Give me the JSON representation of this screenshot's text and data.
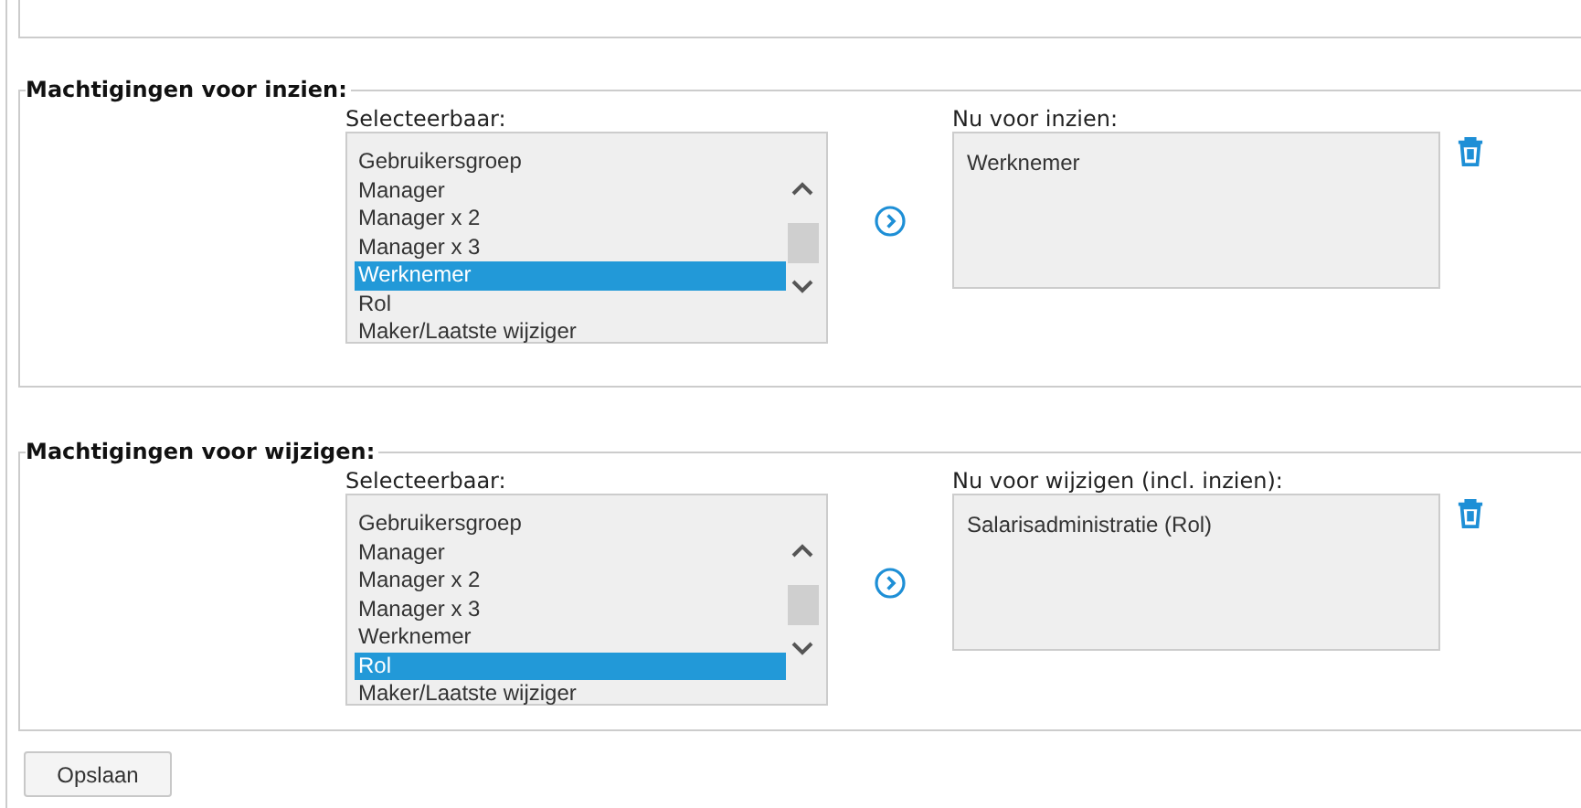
{
  "sections": [
    {
      "legend": "Machtigingen voor inzien:",
      "available_label": "Selecteerbaar:",
      "available": [
        {
          "label": "Gebruikersgroep",
          "selected": false
        },
        {
          "label": "Manager",
          "selected": false
        },
        {
          "label": "Manager x 2",
          "selected": false
        },
        {
          "label": "Manager x 3",
          "selected": false
        },
        {
          "label": "Werknemer",
          "selected": true
        },
        {
          "label": "Rol",
          "selected": false
        },
        {
          "label": "Maker/Laatste wijziger",
          "selected": false
        }
      ],
      "current_label": "Nu voor inzien:",
      "current": [
        "Werknemer"
      ]
    },
    {
      "legend": "Machtigingen voor wijzigen:",
      "available_label": "Selecteerbaar:",
      "available": [
        {
          "label": "Gebruikersgroep",
          "selected": false
        },
        {
          "label": "Manager",
          "selected": false
        },
        {
          "label": "Manager x 2",
          "selected": false
        },
        {
          "label": "Manager x 3",
          "selected": false
        },
        {
          "label": "Werknemer",
          "selected": false
        },
        {
          "label": "Rol",
          "selected": true
        },
        {
          "label": "Maker/Laatste wijziger",
          "selected": false
        }
      ],
      "current_label": "Nu voor wijzigen (incl. inzien):",
      "current": [
        "Salarisadministratie (Rol)"
      ]
    }
  ],
  "save_button": "Opslaan"
}
